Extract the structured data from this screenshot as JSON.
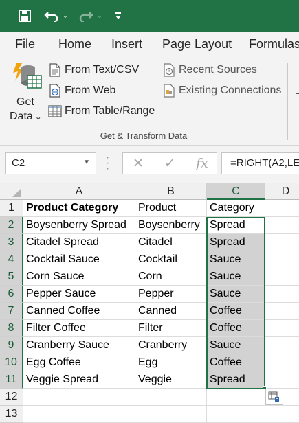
{
  "quick_access": {
    "save_icon": "save-icon",
    "undo_icon": "undo-icon",
    "redo_icon": "redo-icon",
    "customize_icon": "customize-qat-icon"
  },
  "ribbon_tabs": [
    "File",
    "Home",
    "Insert",
    "Page Layout",
    "Formulas"
  ],
  "ribbon": {
    "get_data": {
      "line1": "Get",
      "line2": "Data",
      "caret": "⌄"
    },
    "buttons": {
      "from_text_csv": "From Text/CSV",
      "from_web": "From Web",
      "from_table_range": "From Table/Range",
      "recent_sources": "Recent Sources",
      "existing_connections": "Existing Connections"
    },
    "group_label": "Get & Transform Data"
  },
  "formula_bar": {
    "name_box": "C2",
    "cancel_glyph": "✕",
    "enter_glyph": "✓",
    "fx_glyph": "fx",
    "formula": "=RIGHT(A2,LE"
  },
  "sheet": {
    "columns": [
      "A",
      "B",
      "C",
      "D"
    ],
    "selected_column": "C",
    "rows": [
      {
        "num": "1",
        "a": "Product Category",
        "b": "Product",
        "c": "Category"
      },
      {
        "num": "2",
        "a": "Boysenberry Spread",
        "b": "Boysenberry",
        "c": "Spread"
      },
      {
        "num": "3",
        "a": "Citadel Spread",
        "b": "Citadel",
        "c": "Spread"
      },
      {
        "num": "4",
        "a": "Cocktail Sauce",
        "b": "Cocktail",
        "c": "Sauce"
      },
      {
        "num": "5",
        "a": "Corn Sauce",
        "b": "Corn",
        "c": "Sauce"
      },
      {
        "num": "6",
        "a": "Pepper Sauce",
        "b": "Pepper",
        "c": "Sauce"
      },
      {
        "num": "7",
        "a": "Canned Coffee",
        "b": "Canned",
        "c": "Coffee"
      },
      {
        "num": "8",
        "a": "Filter Coffee",
        "b": "Filter",
        "c": "Coffee"
      },
      {
        "num": "9",
        "a": "Cranberry Sauce",
        "b": "Cranberry",
        "c": "Sauce"
      },
      {
        "num": "10",
        "a": "Egg Coffee",
        "b": "Egg",
        "c": "Coffee"
      },
      {
        "num": "11",
        "a": "Veggie Spread",
        "b": "Veggie",
        "c": "Spread"
      },
      {
        "num": "12",
        "a": "",
        "b": "",
        "c": ""
      },
      {
        "num": "13",
        "a": "",
        "b": "",
        "c": ""
      }
    ],
    "quick_analysis_icon": "flash-fill-options-icon"
  },
  "colors": {
    "excel_green": "#217346",
    "selection_fill": "#d2d2d2"
  }
}
